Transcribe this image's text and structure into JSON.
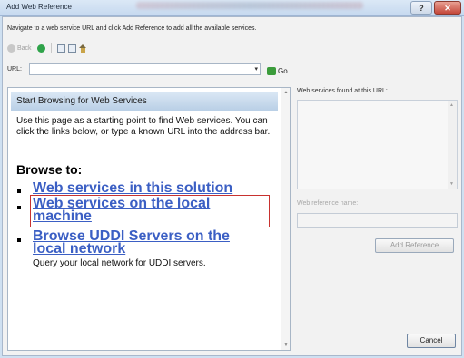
{
  "window": {
    "title": "Add Web Reference",
    "help_glyph": "?",
    "close_glyph": "✕"
  },
  "instruction": "Navigate to a web service URL and click Add Reference to add all the available services.",
  "nav": {
    "back_label": "Back"
  },
  "url": {
    "label": "URL:",
    "value": "",
    "dropdown_glyph": "▾",
    "go_label": "Go"
  },
  "browser": {
    "header": "Start Browsing for Web Services",
    "intro": "Use this page as a starting point to find Web services. You can click the links below, or type a known URL into the address bar.",
    "browse_to": "Browse to:",
    "links": [
      {
        "label": "Web services in this solution"
      },
      {
        "label_line1": "Web services on the local",
        "label_line2": "machine",
        "highlighted": true
      },
      {
        "label_line1": "Browse UDDI Servers on the",
        "label_line2": "local network",
        "description": "Query your local network for UDDI servers."
      }
    ],
    "scroll_up": "▲",
    "scroll_down": "▼"
  },
  "right_panel": {
    "found_label": "Web services found at this URL:",
    "reference_name_label": "Web reference name:",
    "reference_name_value": "",
    "add_reference_button": "Add Reference",
    "cancel_button": "Cancel"
  },
  "colors": {
    "link": "#3b5fc4",
    "highlight_border": "#c8322f",
    "header_bg": "#dbe8f5"
  }
}
